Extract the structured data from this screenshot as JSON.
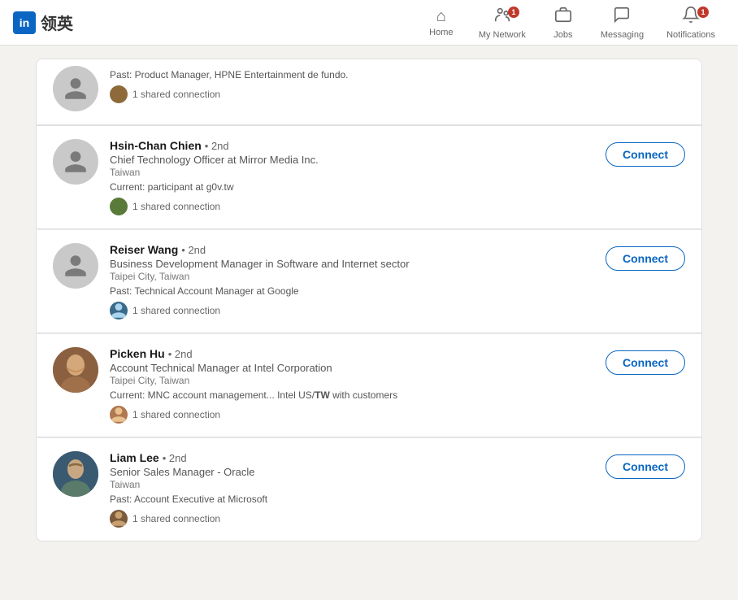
{
  "nav": {
    "logo_text": "领英",
    "items": [
      {
        "id": "home",
        "label": "Home",
        "icon": "⌂",
        "badge": null,
        "active": false
      },
      {
        "id": "my-network",
        "label": "My Network",
        "icon": "👥",
        "badge": "1",
        "active": false
      },
      {
        "id": "jobs",
        "label": "Jobs",
        "icon": "💼",
        "badge": null,
        "active": false
      },
      {
        "id": "messaging",
        "label": "Messaging",
        "icon": "💬",
        "badge": null,
        "active": false
      },
      {
        "id": "notifications",
        "label": "Notifications",
        "icon": "🔔",
        "badge": "1",
        "active": false
      }
    ]
  },
  "top_partial": {
    "past_title": "Past: Product Manager, HPNE Entertainment de fundo.",
    "connection_text": "1 shared connection"
  },
  "people": [
    {
      "id": "hsin-chan-chien",
      "name": "Hsin-Chan Chien",
      "degree": "• 2nd",
      "title": "Chief Technology Officer at Mirror Media Inc.",
      "location": "Taiwan",
      "current": "Current: participant at g0v.tw",
      "connection_text": "1 shared connection",
      "has_photo": false
    },
    {
      "id": "reiser-wang",
      "name": "Reiser Wang",
      "degree": "• 2nd",
      "title": "Business Development Manager in Software and Internet sector",
      "location": "Taipei City, Taiwan",
      "current": "Past: Technical Account Manager at Google",
      "connection_text": "1 shared connection",
      "has_photo": false
    },
    {
      "id": "picken-hu",
      "name": "Picken Hu",
      "degree": "• 2nd",
      "title": "Account Technical Manager at Intel Corporation",
      "location": "Taipei City, Taiwan",
      "current": "Current: MNC account management... Intel US/TW with customers",
      "connection_text": "1 shared connection",
      "has_photo": true
    },
    {
      "id": "liam-lee",
      "name": "Liam Lee",
      "degree": "• 2nd",
      "title": "Senior Sales Manager  -  Oracle",
      "location": "Taiwan",
      "current": "Past: Account Executive at Microsoft",
      "connection_text": "1 shared connection",
      "has_photo": true
    }
  ],
  "connect_label": "Connect"
}
